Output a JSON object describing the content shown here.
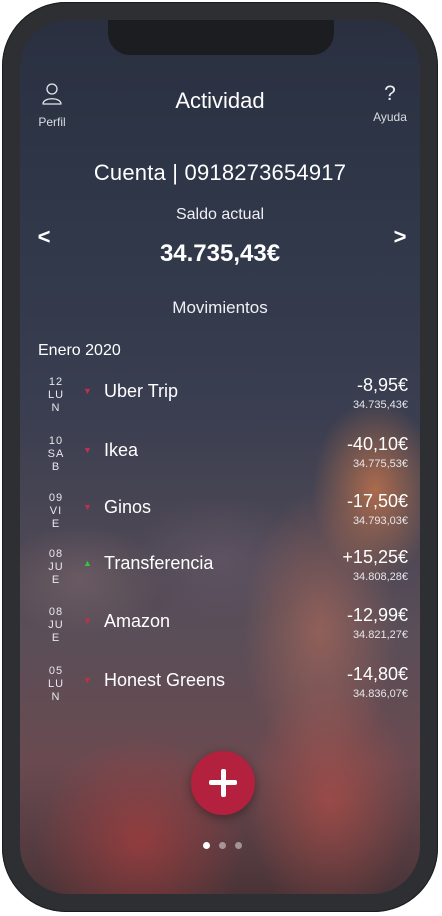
{
  "header": {
    "profile_label": "Perfil",
    "profile_icon": "user-icon",
    "title": "Actividad",
    "help_glyph": "?",
    "help_label": "Ayuda"
  },
  "account": {
    "label": "Cuenta | 0918273654917",
    "balance_label": "Saldo actual",
    "balance": "34.735,43€",
    "prev_arrow": "<",
    "next_arrow": ">"
  },
  "movements": {
    "title": "Movimientos",
    "month": "Enero 2020",
    "items": [
      {
        "day": "12",
        "dow1": "LU",
        "dow2": "N",
        "direction": "down",
        "merchant": "Uber Trip",
        "amount": "-8,95€",
        "balance": "34.735,43€"
      },
      {
        "day": "10",
        "dow1": "SA",
        "dow2": "B",
        "direction": "down",
        "merchant": "Ikea",
        "amount": "-40,10€",
        "balance": "34.775,53€"
      },
      {
        "day": "09",
        "dow1": "VI",
        "dow2": "E",
        "direction": "down",
        "merchant": "Ginos",
        "amount": "-17,50€",
        "balance": "34.793,03€"
      },
      {
        "day": "08",
        "dow1": "JU",
        "dow2": "E",
        "direction": "up",
        "merchant": "Transferencia",
        "amount": "+15,25€",
        "balance": "34.808,28€"
      },
      {
        "day": "08",
        "dow1": "JU",
        "dow2": "E",
        "direction": "down",
        "merchant": "Amazon",
        "amount": "-12,99€",
        "balance": "34.821,27€"
      },
      {
        "day": "05",
        "dow1": "LU",
        "dow2": "N",
        "direction": "down",
        "merchant": "Honest Greens",
        "amount": "-14,80€",
        "balance": "34.836,07€"
      }
    ]
  },
  "colors": {
    "accent": "#b3213e",
    "down_arrow": "#c0304a",
    "up_arrow": "#3cc23c"
  },
  "pager": {
    "count": 3,
    "active": 0
  }
}
